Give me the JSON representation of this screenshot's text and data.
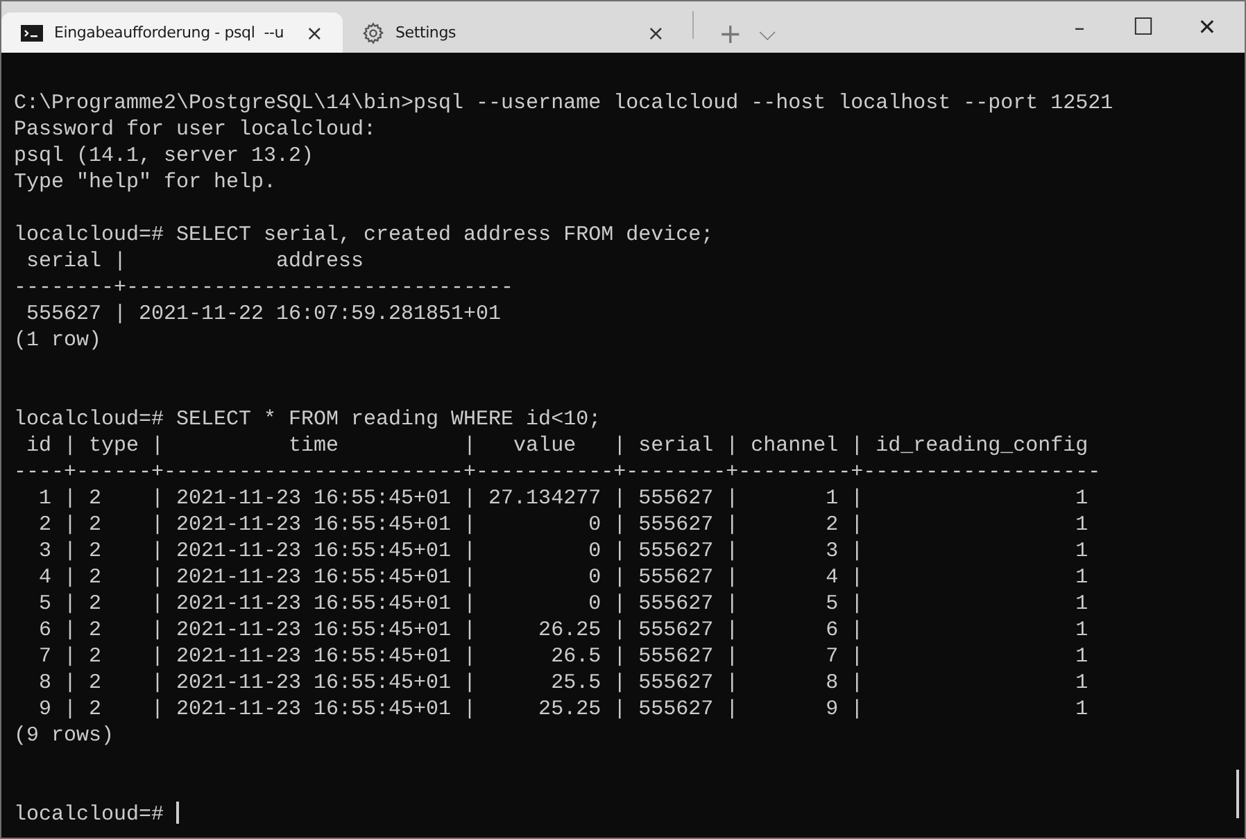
{
  "tabs": [
    {
      "kind": "terminal",
      "title": "Eingabeaufforderung - psql  --u",
      "close": "×",
      "selected": true
    },
    {
      "kind": "settings",
      "title": "Settings",
      "close": "×",
      "selected": false
    }
  ],
  "tab_actions": {
    "new_tab": "+",
    "dropdown": "⌵"
  },
  "window_controls": {
    "minimize": "–",
    "maximize": "☐",
    "close": "✕"
  },
  "terminal": {
    "lines": [
      {
        "kind": "blank"
      },
      {
        "kind": "text",
        "text": "C:\\Programme2\\PostgreSQL\\14\\bin>psql --username localcloud --host localhost --port 12521"
      },
      {
        "kind": "text",
        "text": "Password for user localcloud:"
      },
      {
        "kind": "text",
        "text": "psql (14.1, server 13.2)"
      },
      {
        "kind": "text",
        "text": "Type \"help\" for help."
      },
      {
        "kind": "blank"
      },
      {
        "kind": "text",
        "text": "localcloud=# SELECT serial, created address FROM device;"
      },
      {
        "kind": "text",
        "text": " serial |            address"
      },
      {
        "kind": "text",
        "text": "--------+-------------------------------"
      },
      {
        "kind": "text",
        "text": " 555627 | 2021-11-22 16:07:59.281851+01"
      },
      {
        "kind": "text",
        "text": "(1 row)"
      },
      {
        "kind": "blank"
      },
      {
        "kind": "blank"
      },
      {
        "kind": "text",
        "text": "localcloud=# SELECT * FROM reading WHERE id<10;"
      },
      {
        "kind": "text",
        "text": " id | type |          time          |   value   | serial | channel | id_reading_config"
      },
      {
        "kind": "text",
        "text": "----+------+------------------------+-----------+--------+---------+-------------------"
      },
      {
        "kind": "text",
        "text": "  1 | 2    | 2021-11-23 16:55:45+01 | 27.134277 | 555627 |       1 |                 1"
      },
      {
        "kind": "text",
        "text": "  2 | 2    | 2021-11-23 16:55:45+01 |         0 | 555627 |       2 |                 1"
      },
      {
        "kind": "text",
        "text": "  3 | 2    | 2021-11-23 16:55:45+01 |         0 | 555627 |       3 |                 1"
      },
      {
        "kind": "text",
        "text": "  4 | 2    | 2021-11-23 16:55:45+01 |         0 | 555627 |       4 |                 1"
      },
      {
        "kind": "text",
        "text": "  5 | 2    | 2021-11-23 16:55:45+01 |         0 | 555627 |       5 |                 1"
      },
      {
        "kind": "text",
        "text": "  6 | 2    | 2021-11-23 16:55:45+01 |     26.25 | 555627 |       6 |                 1"
      },
      {
        "kind": "text",
        "text": "  7 | 2    | 2021-11-23 16:55:45+01 |      26.5 | 555627 |       7 |                 1"
      },
      {
        "kind": "text",
        "text": "  8 | 2    | 2021-11-23 16:55:45+01 |      25.5 | 555627 |       8 |                 1"
      },
      {
        "kind": "text",
        "text": "  9 | 2    | 2021-11-23 16:55:45+01 |     25.25 | 555627 |       9 |                 1"
      },
      {
        "kind": "text",
        "text": "(9 rows)"
      },
      {
        "kind": "blank"
      },
      {
        "kind": "blank"
      },
      {
        "kind": "prompt",
        "text": "localcloud=# "
      }
    ]
  }
}
